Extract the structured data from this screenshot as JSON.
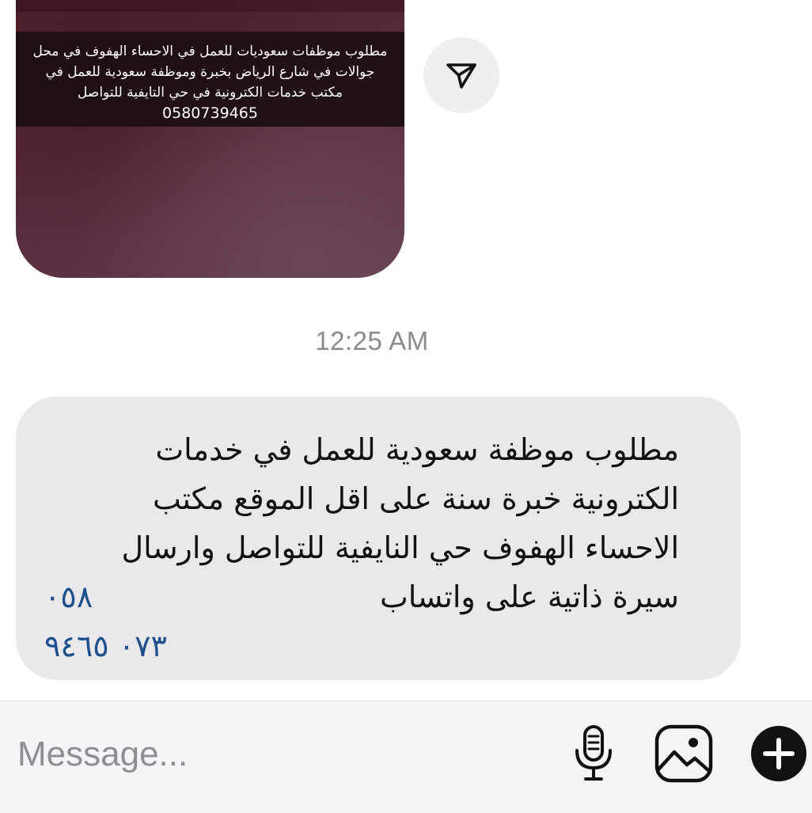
{
  "story": {
    "caption_lines": [
      "مطلوب موظفات سعوديات للعمل في الاحساء الهفوف في محل",
      "جوالات في شارع  الرياض بخبرة وموظفة سعودية للعمل في",
      "مكتب خدمات الكترونية في حي التايفية للتواصل"
    ],
    "caption_phone": "0580739465",
    "share_icon": "paper-plane-icon"
  },
  "timestamp": "12:25 AM",
  "message": {
    "lines": [
      "مطلوب موظفة سعودية للعمل في خدمات",
      "الكترونية خبرة سنة على اقل الموقع مكتب",
      "الاحساء الهفوف حي النايفية للتواصل وارسال",
      "سيرة ذاتية على واتساب"
    ],
    "phone_part1": "٠٥٨",
    "phone_part2": "٠٧٣ ٩٤٦٥",
    "phone_color": "#1d4f8c",
    "bubble_color": "#e9e9eb"
  },
  "composer": {
    "placeholder": "Message...",
    "icons": [
      "microphone-icon",
      "image-icon",
      "plus-circle-icon"
    ]
  }
}
